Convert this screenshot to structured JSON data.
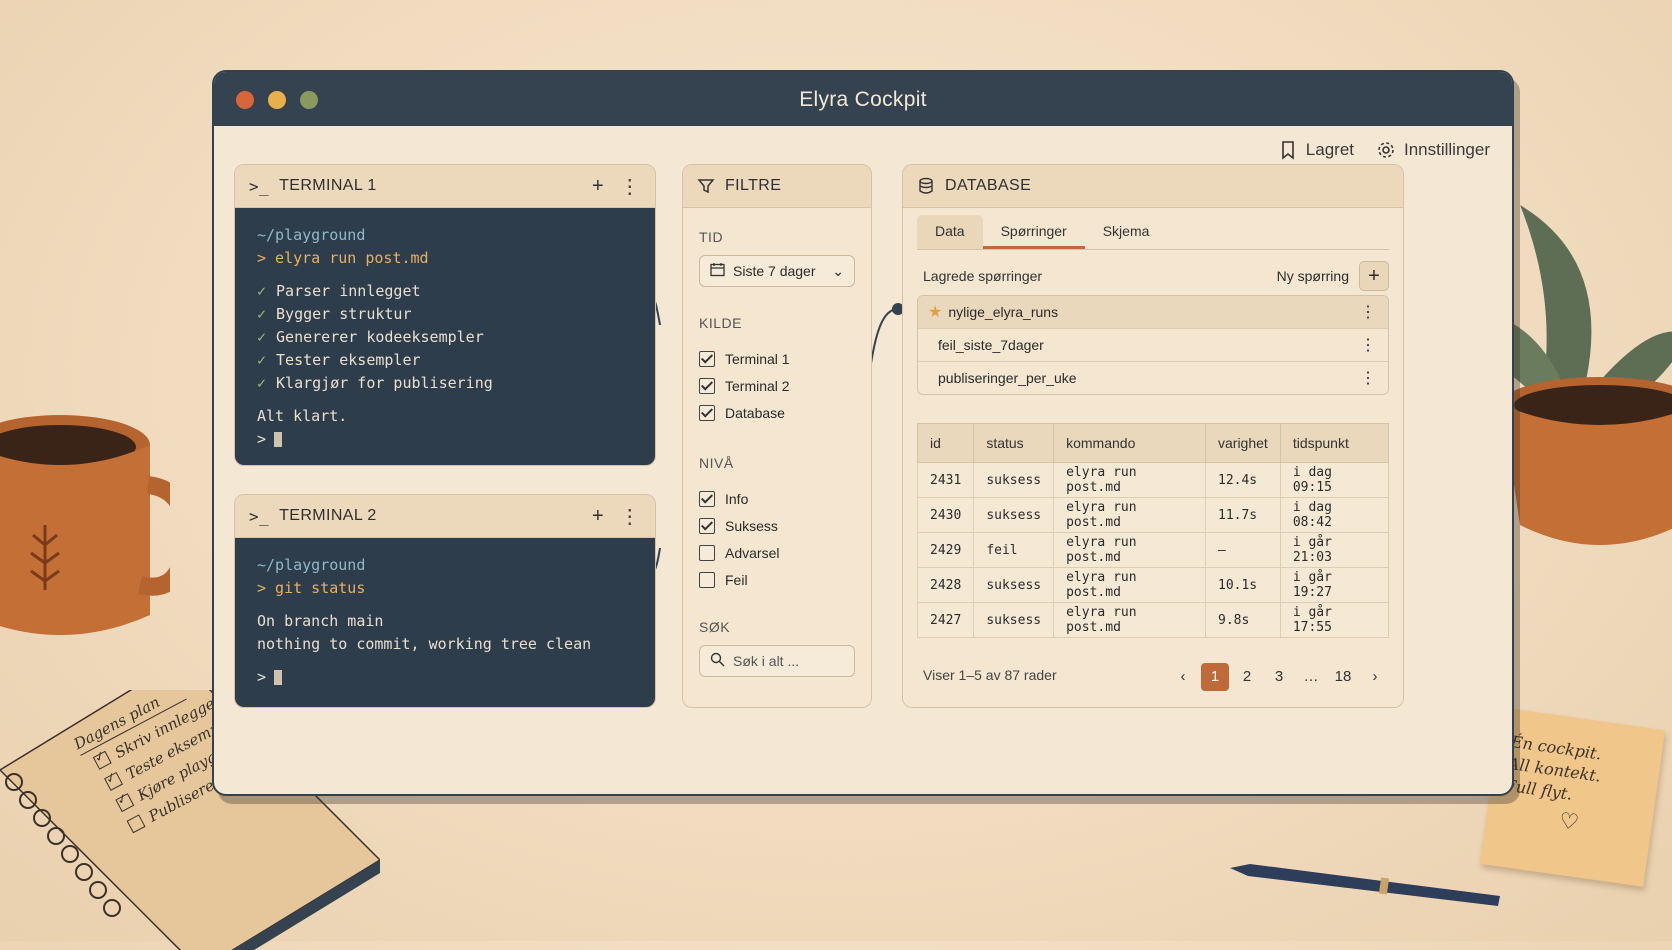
{
  "window": {
    "title": "Elyra Cockpit"
  },
  "toolbar": {
    "saved_label": "Lagret",
    "settings_label": "Innstillinger"
  },
  "terminal1": {
    "title": "TERMINAL 1",
    "prompt_icon": ">_",
    "path": "~/playground",
    "command": "> elyra run post.md",
    "steps": [
      "Parser innlegget",
      "Bygger struktur",
      "Genererer kodeeksempler",
      "Tester eksempler",
      "Klargjør for publisering"
    ],
    "done": "Alt klart.",
    "prompt": ">"
  },
  "terminal2": {
    "title": "TERMINAL 2",
    "prompt_icon": ">_",
    "path": "~/playground",
    "command": "> git status",
    "output": [
      "On branch main",
      "nothing to commit, working tree clean"
    ],
    "prompt": ">"
  },
  "filters": {
    "title": "FILTRE",
    "time_label": "TID",
    "time_value": "Siste 7 dager",
    "source_label": "KILDE",
    "sources": [
      {
        "label": "Terminal 1",
        "checked": true
      },
      {
        "label": "Terminal 2",
        "checked": true
      },
      {
        "label": "Database",
        "checked": true
      }
    ],
    "level_label": "NIVÅ",
    "levels": [
      {
        "label": "Info",
        "checked": true
      },
      {
        "label": "Suksess",
        "checked": true
      },
      {
        "label": "Advarsel",
        "checked": false
      },
      {
        "label": "Feil",
        "checked": false
      }
    ],
    "search_label": "SØK",
    "search_placeholder": "Søk i alt ..."
  },
  "database": {
    "title": "DATABASE",
    "tabs": [
      "Data",
      "Spørringer",
      "Skjema"
    ],
    "active_tab": "Spørringer",
    "saved_queries_label": "Lagrede spørringer",
    "new_query_label": "Ny spørring",
    "queries": [
      "nylige_elyra_runs",
      "feil_siste_7dager",
      "publiseringer_per_uke"
    ],
    "columns": [
      "id",
      "status",
      "kommando",
      "varighet",
      "tidspunkt"
    ],
    "rows": [
      [
        "2431",
        "suksess",
        "elyra run post.md",
        "12.4s",
        "i dag 09:15"
      ],
      [
        "2430",
        "suksess",
        "elyra run post.md",
        "11.7s",
        "i dag 08:42"
      ],
      [
        "2429",
        "feil",
        "elyra run post.md",
        "–",
        "i går 21:03"
      ],
      [
        "2428",
        "suksess",
        "elyra run post.md",
        "10.1s",
        "i går 19:27"
      ],
      [
        "2427",
        "suksess",
        "elyra run post.md",
        "9.8s",
        "i går 17:55"
      ]
    ],
    "pager_text": "Viser 1–5 av 87 rader",
    "pages": [
      "1",
      "2",
      "3",
      "…",
      "18"
    ],
    "current_page": "1"
  },
  "desk": {
    "notebook_title": "Dagens plan",
    "notebook_items": [
      "Skriv innlegget",
      "Teste eksemplene",
      "Kjøre playground",
      "Publisere"
    ],
    "sticky_lines": [
      "Én cockpit.",
      "All kontekt.",
      "Full flyt."
    ],
    "sticky_heart": "♡"
  },
  "colors": {
    "titlebar": "#34434f",
    "terminal_bg": "#2e3d4b",
    "accent": "#c06a3a"
  }
}
